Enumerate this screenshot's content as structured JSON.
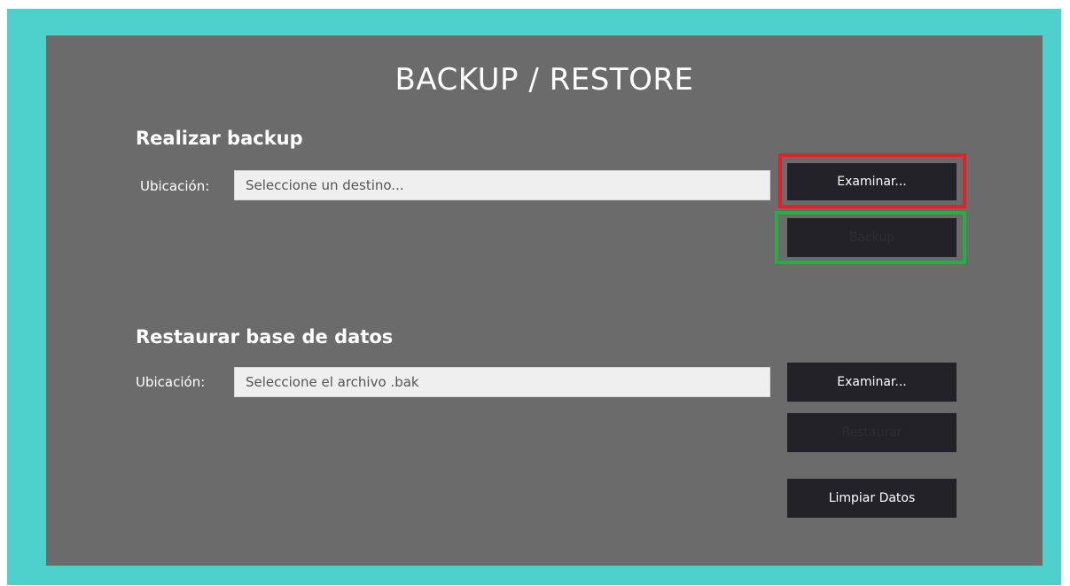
{
  "page": {
    "title": "BACKUP / RESTORE"
  },
  "backup_section": {
    "heading": "Realizar backup",
    "location_label": "Ubicación:",
    "location_placeholder": "Seleccione un destino...",
    "browse_button": "Examinar...",
    "backup_button": "Backup"
  },
  "restore_section": {
    "heading": "Restaurar base de datos",
    "location_label": "Ubicación:",
    "location_placeholder": "Seleccione el archivo .bak",
    "browse_button": "Examinar...",
    "restore_button": "Restaurar",
    "clear_button": "Limpiar Datos"
  },
  "colors": {
    "frame_background": "#4dd0cb",
    "panel_background": "#6b6b6b",
    "button_background": "#232228",
    "highlight_browse": "#e0222b",
    "highlight_backup": "#27ad41"
  }
}
